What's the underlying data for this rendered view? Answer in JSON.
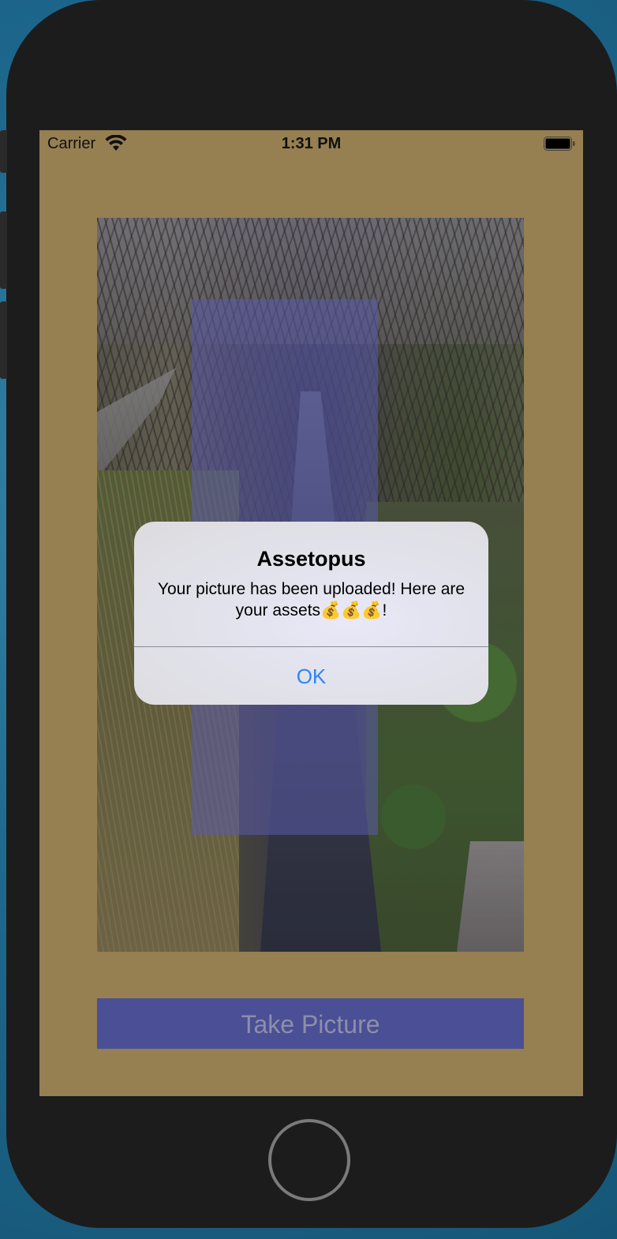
{
  "status_bar": {
    "carrier": "Carrier",
    "time": "1:31 PM",
    "wifi_icon": "wifi-icon",
    "battery_icon": "battery-icon"
  },
  "main": {
    "detection_overlay_color": "#5a5aaa",
    "take_picture_label": "Take Picture",
    "take_picture_color": "#4a4f96",
    "background_color": "#967f51"
  },
  "alert": {
    "title": "Assetopus",
    "message": "Your picture has been uploaded! Here are your assets💰💰💰!",
    "ok_label": "OK",
    "ok_color": "#2f86f3"
  },
  "device": {
    "home_button_icon": "home-button"
  }
}
